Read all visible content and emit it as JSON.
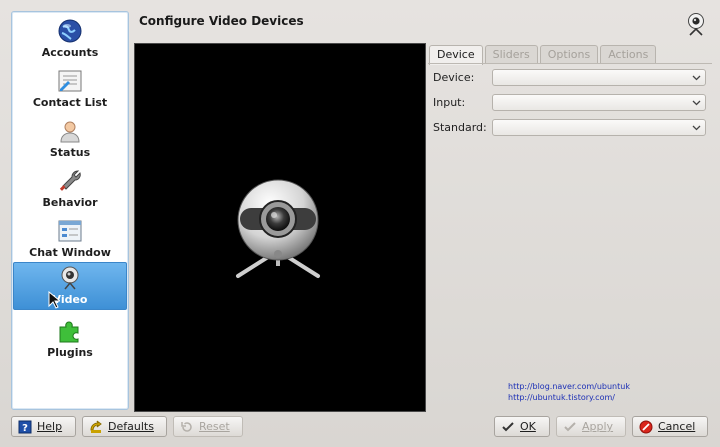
{
  "page": {
    "title": "Configure Video Devices"
  },
  "sidebar": {
    "items": [
      {
        "label": "Accounts",
        "icon": "globe-icon"
      },
      {
        "label": "Contact List",
        "icon": "contact-list-icon"
      },
      {
        "label": "Status",
        "icon": "person-icon"
      },
      {
        "label": "Behavior",
        "icon": "wrench-icon"
      },
      {
        "label": "Chat Window",
        "icon": "chat-window-icon"
      },
      {
        "label": "Video",
        "icon": "webcam-icon",
        "selected": true
      },
      {
        "label": "Plugins",
        "icon": "puzzle-icon"
      }
    ]
  },
  "tabs": [
    {
      "label": "Device",
      "active": true
    },
    {
      "label": "Sliders",
      "active": false
    },
    {
      "label": "Options",
      "active": false
    },
    {
      "label": "Actions",
      "active": false
    }
  ],
  "form": {
    "device_label": "Device:",
    "input_label": "Input:",
    "standard_label": "Standard:",
    "device_value": "",
    "input_value": "",
    "standard_value": ""
  },
  "links": {
    "link1": "http://blog.naver.com/ubuntuk",
    "link2": "http://ubuntuk.tistory.com/"
  },
  "buttons": {
    "help": "Help",
    "defaults": "Defaults",
    "reset": "Reset",
    "ok": "OK",
    "apply": "Apply",
    "cancel": "Cancel"
  },
  "colors": {
    "selection": "#4a9be0",
    "video_background": "#000000",
    "link": "#1b2fb5"
  }
}
